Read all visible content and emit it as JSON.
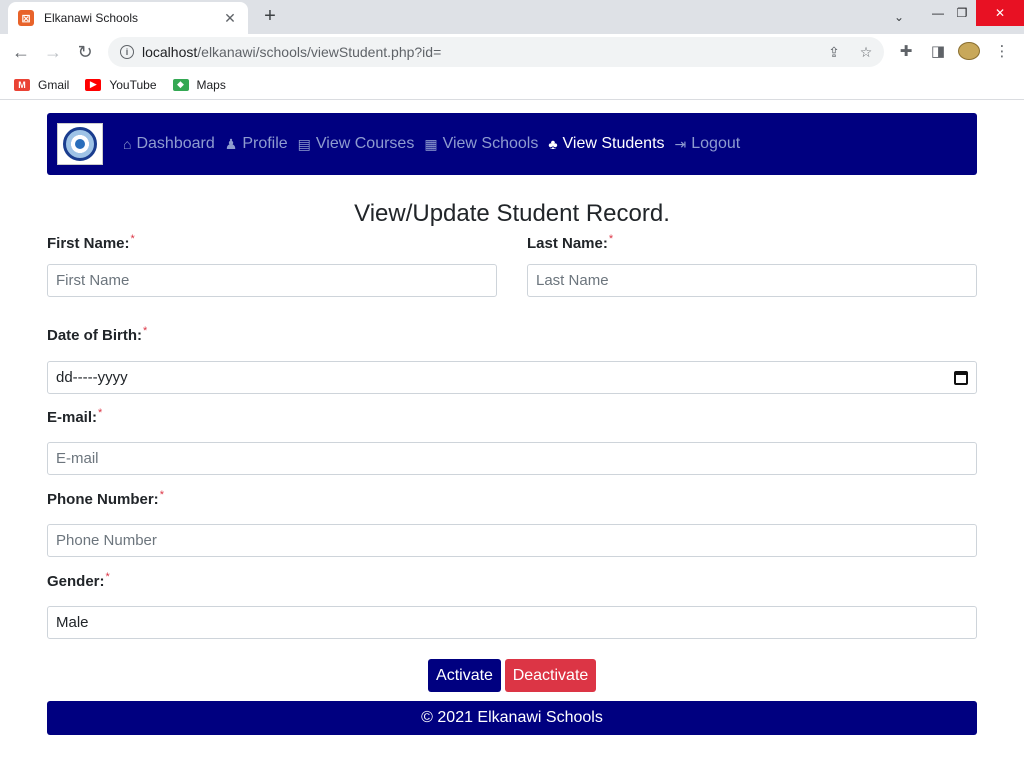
{
  "browser": {
    "tab_title": "Elkanawi Schools",
    "new_tab": "+",
    "url_host": "localhost",
    "url_path": "/elkanawi/schools/viewStudent.php?id=",
    "bookmarks": [
      {
        "label": "Gmail",
        "icon": "gmail-icon",
        "color": "#ea4335"
      },
      {
        "label": "YouTube",
        "icon": "youtube-icon",
        "color": "#ff0000"
      },
      {
        "label": "Maps",
        "icon": "maps-icon",
        "color": "#34a853"
      }
    ]
  },
  "nav": {
    "items": [
      {
        "label": "Dashboard",
        "icon": "home-icon"
      },
      {
        "label": "Profile",
        "icon": "user-icon"
      },
      {
        "label": "View Courses",
        "icon": "book-icon"
      },
      {
        "label": "View Schools",
        "icon": "building-icon"
      },
      {
        "label": "View Students",
        "icon": "users-icon",
        "active": true
      },
      {
        "label": "Logout",
        "icon": "sign-out-icon"
      }
    ],
    "background": "#000080"
  },
  "form": {
    "heading": "View/Update Student Record.",
    "required_mark": "*",
    "first_name": {
      "label": "First Name:",
      "placeholder": "First Name",
      "value": ""
    },
    "last_name": {
      "label": "Last Name:",
      "placeholder": "Last Name",
      "value": ""
    },
    "dob": {
      "label": "Date of Birth:",
      "placeholder": "dd-----yyyy"
    },
    "email": {
      "label": "E-mail:",
      "placeholder": "E-mail",
      "value": ""
    },
    "phone": {
      "label": "Phone Number:",
      "placeholder": "Phone Number",
      "value": ""
    },
    "gender": {
      "label": "Gender:",
      "value": "Male"
    }
  },
  "actions": {
    "activate": "Activate",
    "deactivate": "Deactivate",
    "activate_color": "#000080",
    "deactivate_color": "#dc3545"
  },
  "footer": {
    "text": "© 2021 Elkanawi Schools"
  }
}
